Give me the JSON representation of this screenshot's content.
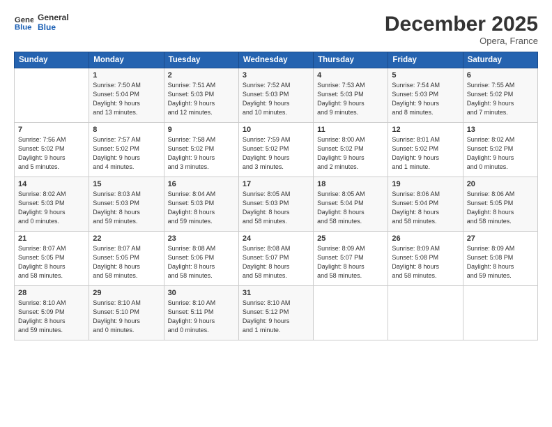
{
  "header": {
    "logo_line1": "General",
    "logo_line2": "Blue",
    "month": "December 2025",
    "location": "Opera, France"
  },
  "weekdays": [
    "Sunday",
    "Monday",
    "Tuesday",
    "Wednesday",
    "Thursday",
    "Friday",
    "Saturday"
  ],
  "weeks": [
    [
      {
        "day": "",
        "info": ""
      },
      {
        "day": "1",
        "info": "Sunrise: 7:50 AM\nSunset: 5:04 PM\nDaylight: 9 hours\nand 13 minutes."
      },
      {
        "day": "2",
        "info": "Sunrise: 7:51 AM\nSunset: 5:03 PM\nDaylight: 9 hours\nand 12 minutes."
      },
      {
        "day": "3",
        "info": "Sunrise: 7:52 AM\nSunset: 5:03 PM\nDaylight: 9 hours\nand 10 minutes."
      },
      {
        "day": "4",
        "info": "Sunrise: 7:53 AM\nSunset: 5:03 PM\nDaylight: 9 hours\nand 9 minutes."
      },
      {
        "day": "5",
        "info": "Sunrise: 7:54 AM\nSunset: 5:03 PM\nDaylight: 9 hours\nand 8 minutes."
      },
      {
        "day": "6",
        "info": "Sunrise: 7:55 AM\nSunset: 5:02 PM\nDaylight: 9 hours\nand 7 minutes."
      }
    ],
    [
      {
        "day": "7",
        "info": "Sunrise: 7:56 AM\nSunset: 5:02 PM\nDaylight: 9 hours\nand 5 minutes."
      },
      {
        "day": "8",
        "info": "Sunrise: 7:57 AM\nSunset: 5:02 PM\nDaylight: 9 hours\nand 4 minutes."
      },
      {
        "day": "9",
        "info": "Sunrise: 7:58 AM\nSunset: 5:02 PM\nDaylight: 9 hours\nand 3 minutes."
      },
      {
        "day": "10",
        "info": "Sunrise: 7:59 AM\nSunset: 5:02 PM\nDaylight: 9 hours\nand 3 minutes."
      },
      {
        "day": "11",
        "info": "Sunrise: 8:00 AM\nSunset: 5:02 PM\nDaylight: 9 hours\nand 2 minutes."
      },
      {
        "day": "12",
        "info": "Sunrise: 8:01 AM\nSunset: 5:02 PM\nDaylight: 9 hours\nand 1 minute."
      },
      {
        "day": "13",
        "info": "Sunrise: 8:02 AM\nSunset: 5:02 PM\nDaylight: 9 hours\nand 0 minutes."
      }
    ],
    [
      {
        "day": "14",
        "info": "Sunrise: 8:02 AM\nSunset: 5:03 PM\nDaylight: 9 hours\nand 0 minutes."
      },
      {
        "day": "15",
        "info": "Sunrise: 8:03 AM\nSunset: 5:03 PM\nDaylight: 8 hours\nand 59 minutes."
      },
      {
        "day": "16",
        "info": "Sunrise: 8:04 AM\nSunset: 5:03 PM\nDaylight: 8 hours\nand 59 minutes."
      },
      {
        "day": "17",
        "info": "Sunrise: 8:05 AM\nSunset: 5:03 PM\nDaylight: 8 hours\nand 58 minutes."
      },
      {
        "day": "18",
        "info": "Sunrise: 8:05 AM\nSunset: 5:04 PM\nDaylight: 8 hours\nand 58 minutes."
      },
      {
        "day": "19",
        "info": "Sunrise: 8:06 AM\nSunset: 5:04 PM\nDaylight: 8 hours\nand 58 minutes."
      },
      {
        "day": "20",
        "info": "Sunrise: 8:06 AM\nSunset: 5:05 PM\nDaylight: 8 hours\nand 58 minutes."
      }
    ],
    [
      {
        "day": "21",
        "info": "Sunrise: 8:07 AM\nSunset: 5:05 PM\nDaylight: 8 hours\nand 58 minutes."
      },
      {
        "day": "22",
        "info": "Sunrise: 8:07 AM\nSunset: 5:05 PM\nDaylight: 8 hours\nand 58 minutes."
      },
      {
        "day": "23",
        "info": "Sunrise: 8:08 AM\nSunset: 5:06 PM\nDaylight: 8 hours\nand 58 minutes."
      },
      {
        "day": "24",
        "info": "Sunrise: 8:08 AM\nSunset: 5:07 PM\nDaylight: 8 hours\nand 58 minutes."
      },
      {
        "day": "25",
        "info": "Sunrise: 8:09 AM\nSunset: 5:07 PM\nDaylight: 8 hours\nand 58 minutes."
      },
      {
        "day": "26",
        "info": "Sunrise: 8:09 AM\nSunset: 5:08 PM\nDaylight: 8 hours\nand 58 minutes."
      },
      {
        "day": "27",
        "info": "Sunrise: 8:09 AM\nSunset: 5:08 PM\nDaylight: 8 hours\nand 59 minutes."
      }
    ],
    [
      {
        "day": "28",
        "info": "Sunrise: 8:10 AM\nSunset: 5:09 PM\nDaylight: 8 hours\nand 59 minutes."
      },
      {
        "day": "29",
        "info": "Sunrise: 8:10 AM\nSunset: 5:10 PM\nDaylight: 9 hours\nand 0 minutes."
      },
      {
        "day": "30",
        "info": "Sunrise: 8:10 AM\nSunset: 5:11 PM\nDaylight: 9 hours\nand 0 minutes."
      },
      {
        "day": "31",
        "info": "Sunrise: 8:10 AM\nSunset: 5:12 PM\nDaylight: 9 hours\nand 1 minute."
      },
      {
        "day": "",
        "info": ""
      },
      {
        "day": "",
        "info": ""
      },
      {
        "day": "",
        "info": ""
      }
    ]
  ]
}
